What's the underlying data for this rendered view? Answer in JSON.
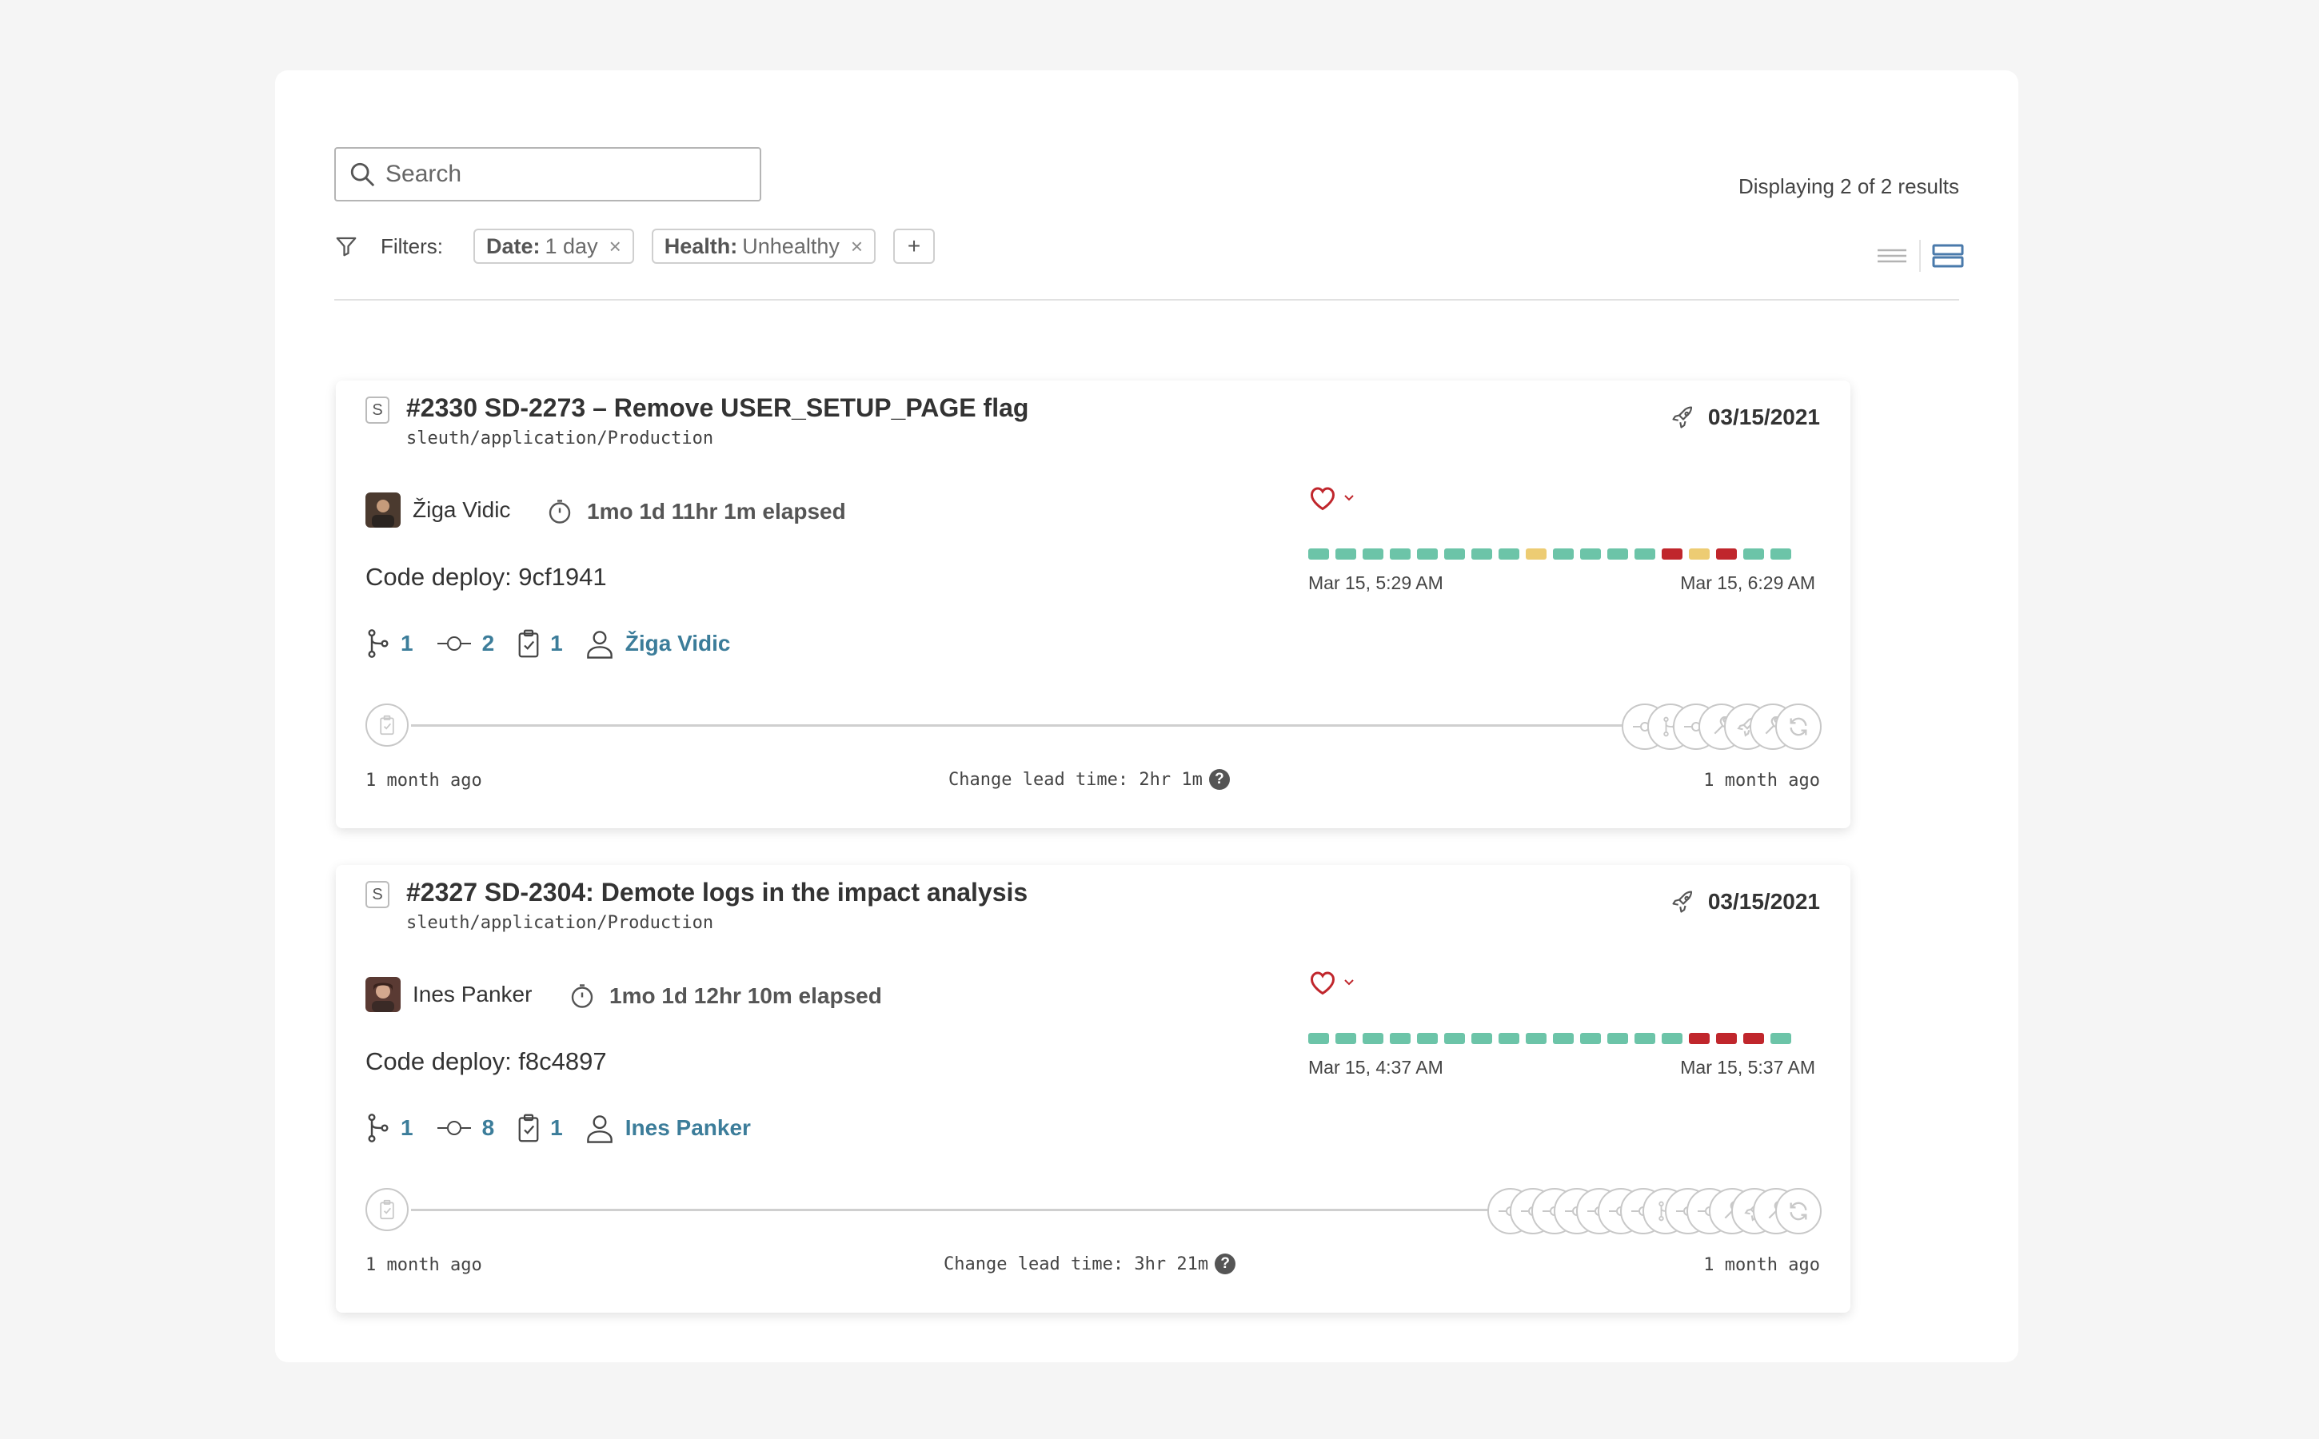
{
  "search": {
    "placeholder": "Search"
  },
  "results_text": "Displaying 2 of 2 results",
  "filters": {
    "label": "Filters:",
    "chips": [
      {
        "key": "Date:",
        "value": "1 day"
      },
      {
        "key": "Health:",
        "value": "Unhealthy"
      }
    ],
    "add_label": "+",
    "remove_glyph": "×"
  },
  "colors": {
    "healthy": "#6cc4a8",
    "warning": "#edcc73",
    "unhealthy": "#c0262c",
    "link": "#3c7d9a",
    "view_active": "#4a7aab"
  },
  "deployments": [
    {
      "badge": "S",
      "title": "#2330 SD-2273 – Remove USER_SETUP_PAGE flag",
      "path": "sleuth/application/Production",
      "date": "03/15/2021",
      "author": "Žiga Vidic",
      "elapsed": "1mo 1d 11hr 1m elapsed",
      "deploy": "Code deploy: 9cf1941",
      "stats": {
        "pull_requests": "1",
        "commits": "2",
        "issues": "1",
        "author_link": "Žiga Vidic"
      },
      "health_timeline": [
        "healthy",
        "healthy",
        "healthy",
        "healthy",
        "healthy",
        "healthy",
        "healthy",
        "healthy",
        "warning",
        "healthy",
        "healthy",
        "healthy",
        "healthy",
        "unhealthy",
        "warning",
        "unhealthy",
        "healthy",
        "healthy"
      ],
      "time_start": "Mar 15, 5:29 AM",
      "time_end": "Mar 15, 6:29 AM",
      "ago_left": "1 month ago",
      "lead_time": "Change lead time: 2hr 1m",
      "ago_right": "1 month ago",
      "flow_nodes": [
        "commit-icon",
        "branch-icon",
        "commit-icon",
        "wrench-icon",
        "rocket-icon",
        "wrench-icon",
        "refresh-icon"
      ]
    },
    {
      "badge": "S",
      "title": "#2327 SD-2304: Demote logs in the impact analysis",
      "path": "sleuth/application/Production",
      "date": "03/15/2021",
      "author": "Ines Panker",
      "elapsed": "1mo 1d 12hr 10m elapsed",
      "deploy": "Code deploy: f8c4897",
      "stats": {
        "pull_requests": "1",
        "commits": "8",
        "issues": "1",
        "author_link": "Ines Panker"
      },
      "health_timeline": [
        "healthy",
        "healthy",
        "healthy",
        "healthy",
        "healthy",
        "healthy",
        "healthy",
        "healthy",
        "healthy",
        "healthy",
        "healthy",
        "healthy",
        "healthy",
        "healthy",
        "unhealthy",
        "unhealthy",
        "unhealthy",
        "healthy"
      ],
      "time_start": "Mar 15, 4:37 AM",
      "time_end": "Mar 15, 5:37 AM",
      "ago_left": "1 month ago",
      "lead_time": "Change lead time: 3hr 21m",
      "ago_right": "1 month ago",
      "flow_nodes": [
        "commit-icon",
        "commit-icon",
        "commit-icon",
        "commit-icon",
        "commit-icon",
        "commit-icon",
        "commit-icon",
        "branch-icon",
        "commit-icon",
        "commit-icon",
        "wrench-icon",
        "rocket-icon",
        "wrench-icon",
        "refresh-icon"
      ]
    }
  ]
}
